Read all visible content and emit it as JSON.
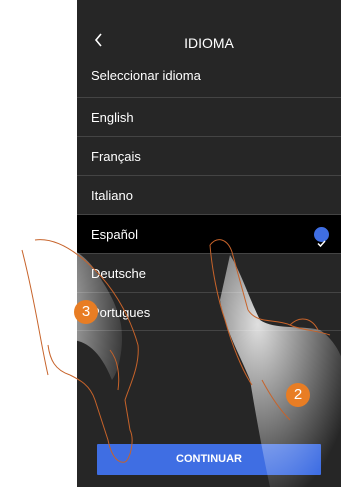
{
  "header": {
    "title": "IDIOMA",
    "back_icon": "chevron-left-icon"
  },
  "subtitle": "Seleccionar idioma",
  "languages": [
    {
      "label": "English",
      "selected": false
    },
    {
      "label": "Français",
      "selected": false
    },
    {
      "label": "Italiano",
      "selected": false
    },
    {
      "label": "Español",
      "selected": true
    },
    {
      "label": "Deutsche",
      "selected": false
    },
    {
      "label": "Portugues",
      "selected": false
    }
  ],
  "continue_label": "CONTINUAR",
  "steps": {
    "first": "2",
    "second": "3"
  },
  "colors": {
    "background": "#262626",
    "selected_row": "#000000",
    "accent": "#3f6ee3",
    "step_badge": "#e87d24"
  }
}
